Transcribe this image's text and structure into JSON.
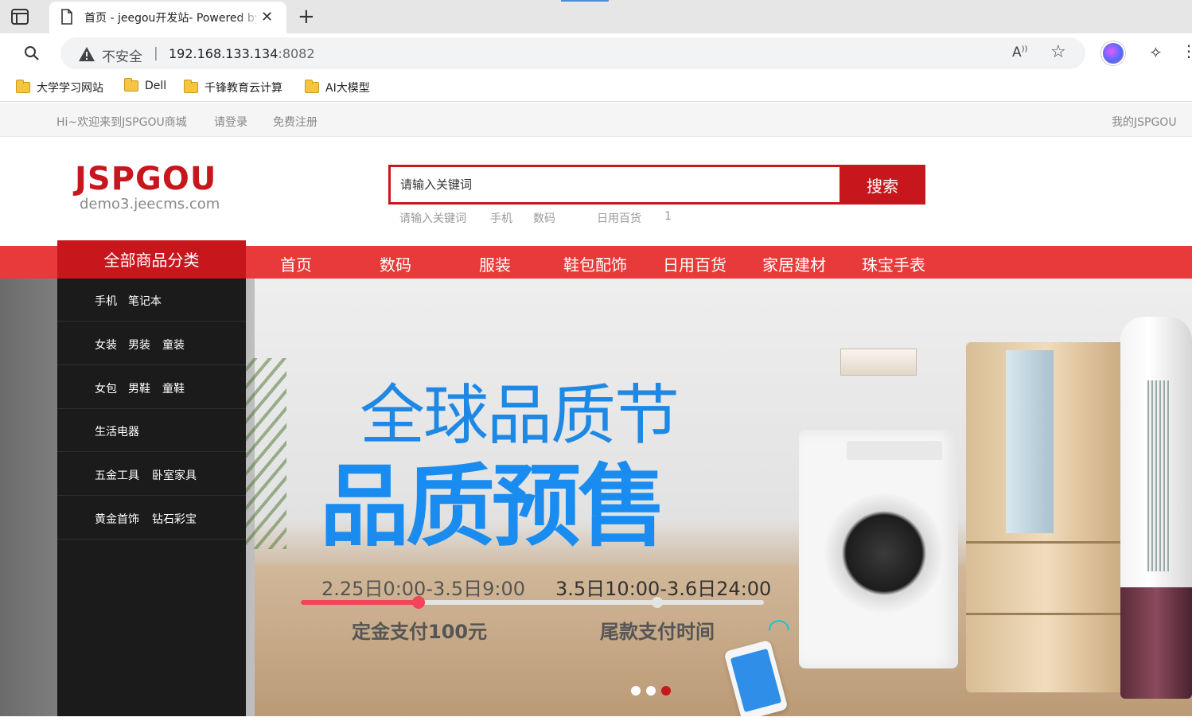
{
  "browser": {
    "tab_title": "首页 - jeegou开发站- Powered by",
    "tab_close": "✕",
    "new_tab": "+",
    "security_label": "不安全",
    "url_host": "192.168.133.134",
    "url_port": ":8082",
    "bookmarks": [
      "大学学习网站",
      "Dell",
      "千锋教育云计算",
      "AI大模型"
    ]
  },
  "topbar": {
    "welcome": "Hi~欢迎来到JSPGOU商城",
    "login": "请登录",
    "register": "免费注册",
    "my_account": "我的JSPGOU"
  },
  "logo": {
    "brand": "JSPGOU",
    "domain": "demo3.jeecms.com"
  },
  "search": {
    "placeholder": "请输入关键词",
    "button": "搜索",
    "hot_words": [
      "请输入关键词",
      "手机",
      "数码",
      "日用百货",
      "1"
    ]
  },
  "nav": {
    "all_categories": "全部商品分类",
    "items": [
      "首页",
      "数码",
      "服装",
      "鞋包配饰",
      "日用百货",
      "家居建材",
      "珠宝手表"
    ]
  },
  "categories": [
    [
      "手机",
      "笔记本"
    ],
    [
      "女装",
      "男装",
      "童装"
    ],
    [
      "女包",
      "男鞋",
      "童鞋"
    ],
    [
      "生活电器"
    ],
    [
      "五金工具",
      "卧室家具"
    ],
    [
      "黄金首饰",
      "钻石彩宝"
    ]
  ],
  "banner": {
    "headline1": "全球品质节",
    "headline2": "品质预售",
    "date1": "2.25日0:00-3.5日9:00",
    "date2": "3.5日10:00-3.6日24:00",
    "step1": "定金支付100元",
    "step2": "尾款支付时间",
    "slides": 3,
    "active_slide": 3
  },
  "colors": {
    "brand_red": "#c8161d",
    "nav_red": "#e83a3a",
    "headline_blue": "#1a8cf0"
  }
}
